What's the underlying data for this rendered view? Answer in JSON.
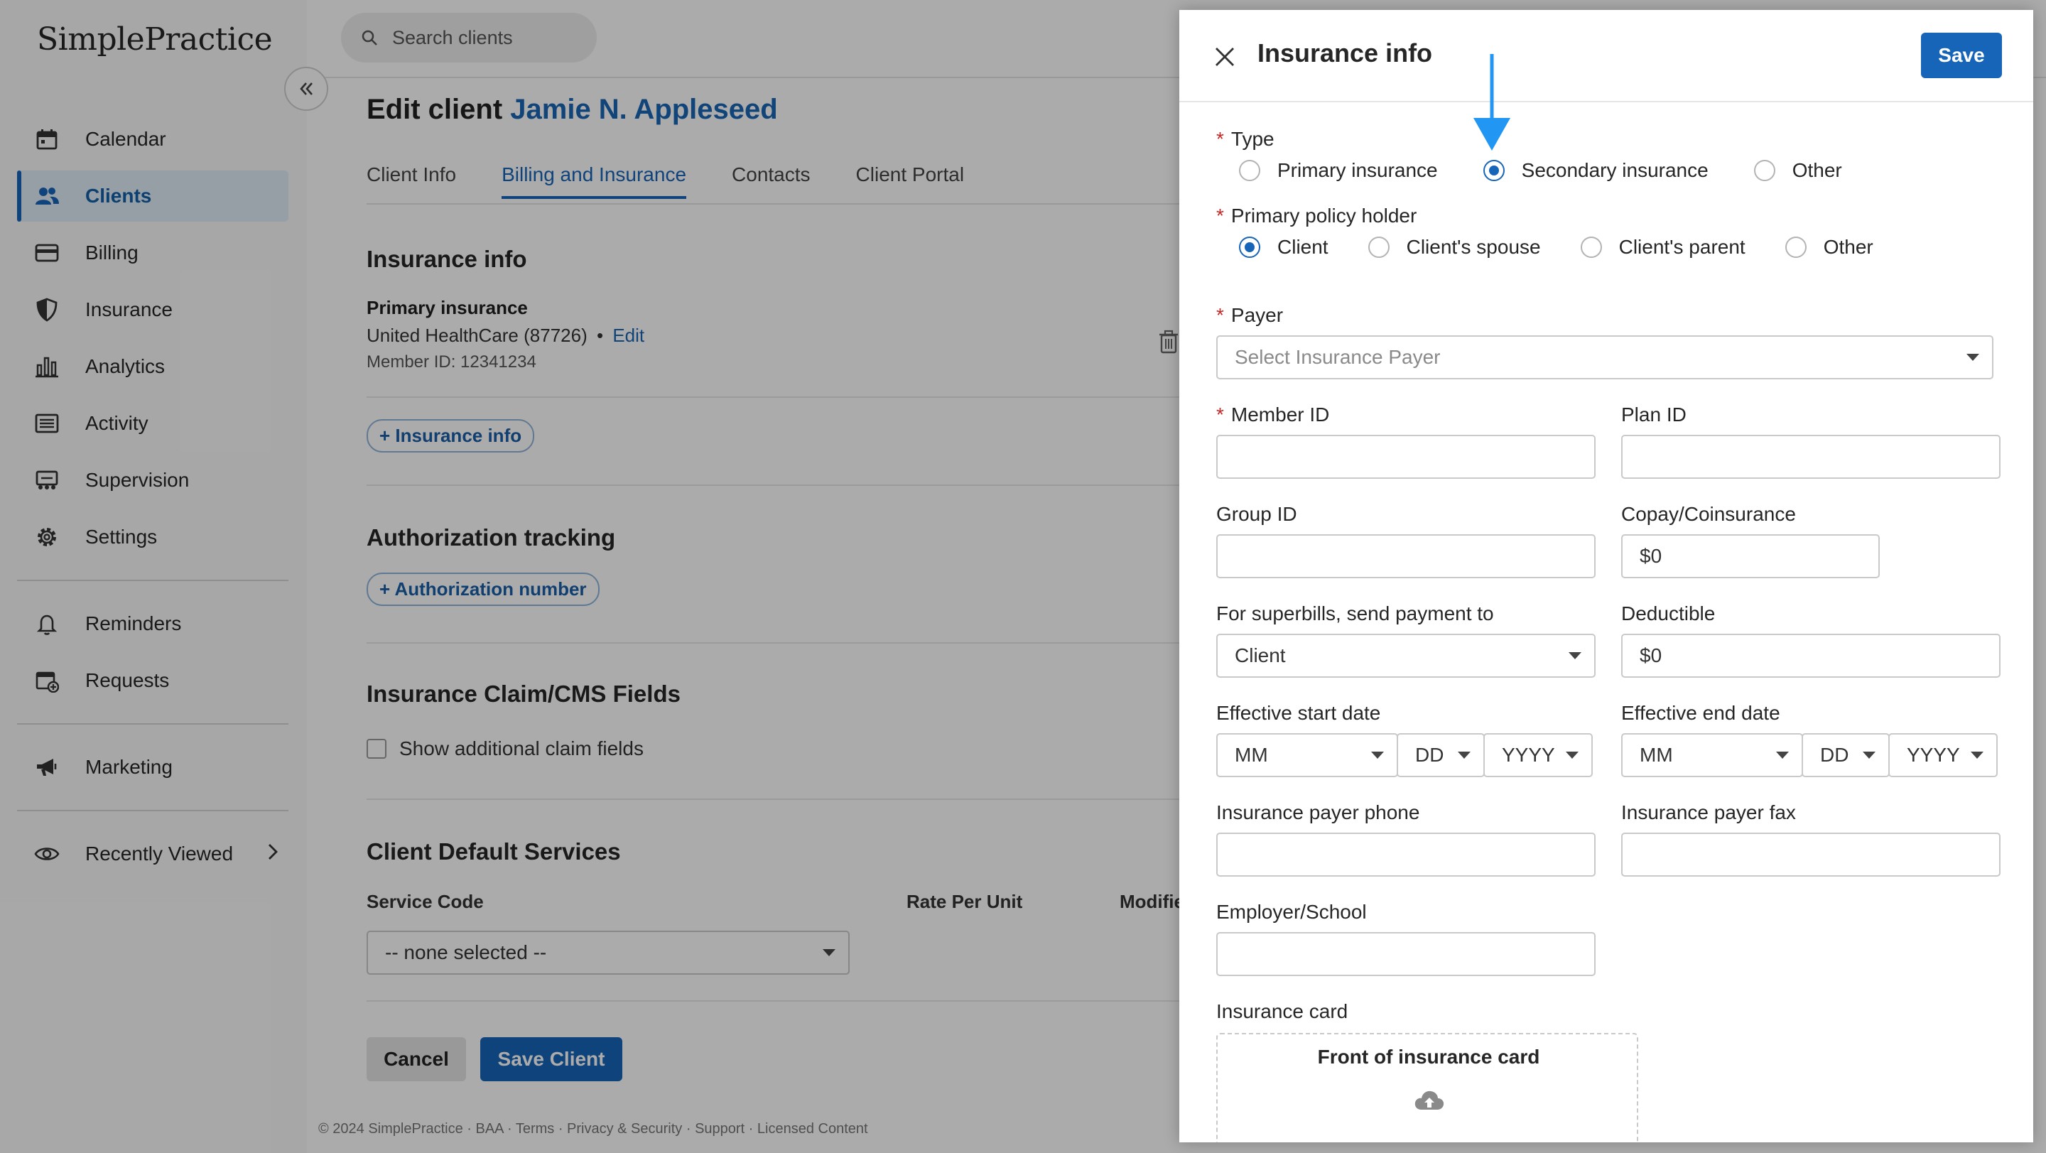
{
  "brand": {
    "logo": "SimplePractice"
  },
  "sidebar": {
    "items": [
      {
        "label": "Calendar",
        "icon": "calendar-icon"
      },
      {
        "label": "Clients",
        "icon": "people-icon",
        "active": true
      },
      {
        "label": "Billing",
        "icon": "credit-card-icon"
      },
      {
        "label": "Insurance",
        "icon": "shield-icon"
      },
      {
        "label": "Analytics",
        "icon": "bar-chart-icon"
      },
      {
        "label": "Activity",
        "icon": "list-icon"
      },
      {
        "label": "Supervision",
        "icon": "supervision-icon"
      },
      {
        "label": "Settings",
        "icon": "gear-icon"
      }
    ],
    "items2": [
      {
        "label": "Reminders",
        "icon": "bell-icon"
      },
      {
        "label": "Requests",
        "icon": "calendar-plus-icon"
      }
    ],
    "marketing": {
      "label": "Marketing",
      "icon": "megaphone-icon"
    },
    "recent": {
      "label": "Recently Viewed",
      "icon": "eye-icon"
    }
  },
  "header": {
    "search_placeholder": "Search clients"
  },
  "page": {
    "title_prefix": "Edit client",
    "client_name": "Jamie N. Appleseed",
    "tabs": [
      "Client Info",
      "Billing and Insurance",
      "Contacts",
      "Client Portal"
    ],
    "insurance": {
      "heading": "Insurance info",
      "primary_label": "Primary insurance",
      "payer_line": "United HealthCare (87726)",
      "edit_link": "Edit",
      "member_id": "Member ID: 12341234",
      "add_button": "+ Insurance info"
    },
    "auth": {
      "heading": "Authorization tracking",
      "add_button": "+ Authorization number"
    },
    "claim": {
      "heading": "Insurance Claim/CMS Fields",
      "checkbox_label": "Show additional claim fields"
    },
    "services": {
      "heading": "Client Default Services",
      "col_service_code": "Service Code",
      "col_rate": "Rate Per Unit",
      "col_modifier": "Modifie",
      "select_value": "-- none selected --"
    },
    "buttons": {
      "cancel": "Cancel",
      "save": "Save Client"
    },
    "footer": "© 2024 SimplePractice · BAA · Terms · Privacy & Security · Support · Licensed Content"
  },
  "drawer": {
    "title": "Insurance info",
    "save": "Save",
    "required_mark": "*",
    "type": {
      "label": "Type",
      "options": [
        "Primary insurance",
        "Secondary insurance",
        "Other"
      ],
      "selected": "Secondary insurance"
    },
    "holder": {
      "label": "Primary policy holder",
      "options": [
        "Client",
        "Client's spouse",
        "Client's parent",
        "Other"
      ],
      "selected": "Client"
    },
    "payer": {
      "label": "Payer",
      "placeholder": "Select Insurance Payer"
    },
    "member_id": {
      "label": "Member ID",
      "value": ""
    },
    "plan_id": {
      "label": "Plan ID",
      "value": ""
    },
    "group_id": {
      "label": "Group ID",
      "value": ""
    },
    "copay": {
      "label": "Copay/Coinsurance",
      "value": "$0"
    },
    "superbills": {
      "label": "For superbills, send payment to",
      "value": "Client"
    },
    "deductible": {
      "label": "Deductible",
      "value": "$0"
    },
    "start_date": {
      "label": "Effective start date",
      "mm": "MM",
      "dd": "DD",
      "yyyy": "YYYY"
    },
    "end_date": {
      "label": "Effective end date",
      "mm": "MM",
      "dd": "DD",
      "yyyy": "YYYY"
    },
    "payer_phone": {
      "label": "Insurance payer phone",
      "value": ""
    },
    "payer_fax": {
      "label": "Insurance payer fax",
      "value": ""
    },
    "employer": {
      "label": "Employer/School",
      "value": ""
    },
    "card": {
      "label": "Insurance card",
      "front": "Front of insurance card"
    }
  },
  "colors": {
    "accent": "#1765b8",
    "annotation_arrow": "#2196f3"
  }
}
